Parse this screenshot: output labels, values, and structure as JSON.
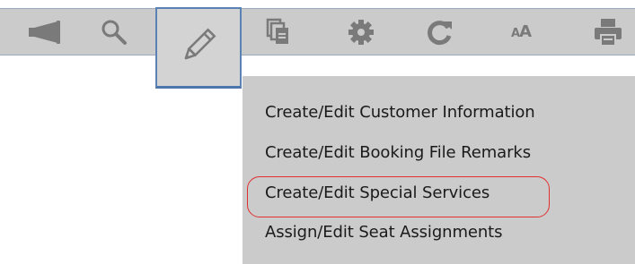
{
  "toolbar": {
    "icons": [
      {
        "name": "megaphone-icon"
      },
      {
        "name": "search-icon"
      },
      {
        "name": "pencil-icon",
        "active": true
      },
      {
        "name": "copy-pages-icon"
      },
      {
        "name": "gear-icon"
      },
      {
        "name": "refresh-icon"
      },
      {
        "name": "font-size-icon",
        "label": "AA"
      },
      {
        "name": "printer-icon"
      }
    ]
  },
  "menu": {
    "items": [
      {
        "label": "Create/Edit Customer Information"
      },
      {
        "label": "Create/Edit Booking File Remarks"
      },
      {
        "label": "Create/Edit Special Services",
        "highlighted": true
      },
      {
        "label": "Assign/Edit Seat Assignments"
      }
    ]
  },
  "colors": {
    "toolbar_bg": "#cbcbcb",
    "icon_gray": "#7a7a7a",
    "active_border": "#5b82b5",
    "highlight_ring": "#e03030"
  }
}
